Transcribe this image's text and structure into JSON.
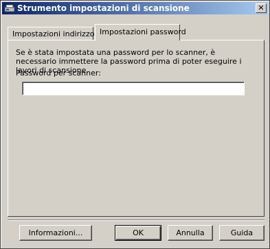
{
  "window": {
    "title": "Strumento impostazioni di scansione",
    "close_symbol": "✕"
  },
  "tabs": [
    {
      "label": "Impostazioni indirizzo IP",
      "active": false
    },
    {
      "label": "Impostazioni password",
      "active": true
    }
  ],
  "panel": {
    "description": "Se è stata impostata una password per lo scanner, è necessario immettere la password prima di poter eseguire i lavori di scansione.",
    "password_label": "Password per scanner:",
    "password_value": ""
  },
  "buttons": {
    "info": "Informazioni...",
    "ok": "OK",
    "cancel": "Annulla",
    "help": "Guida"
  }
}
